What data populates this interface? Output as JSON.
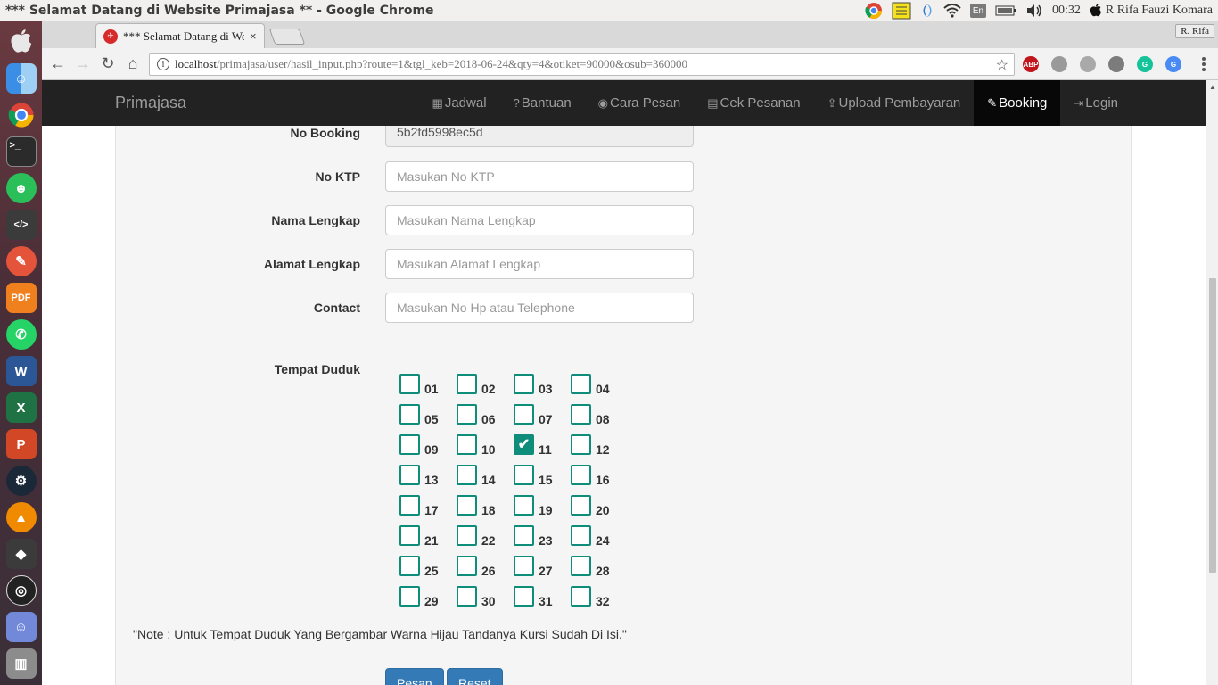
{
  "os": {
    "window_title": "*** Selamat Datang di Website Primajasa ** - Google Chrome",
    "tray": {
      "lang": "En",
      "clock": "00:32",
      "user": "R Rifa Fauzi Komara"
    },
    "launcher_icons": [
      "apple-icon",
      "finder-icon",
      "chrome-icon",
      "terminal-icon",
      "android-icon",
      "code-editor-icon",
      "pen-icon",
      "pdf-icon",
      "whatsapp-icon",
      "word-icon",
      "excel-icon",
      "powerpoint-icon",
      "steam-icon",
      "vlc-icon",
      "inkscape-icon",
      "obs-icon",
      "discord-icon",
      "trash-icon"
    ]
  },
  "browser": {
    "tab_title": "*** Selamat Datang di We",
    "tab_close": "×",
    "profile": "R. Rifa",
    "url_host": "localhost",
    "url_path": "/primajasa/user/hasil_input.php?route=1&tgl_keb=2018-06-24&qty=4&otiket=90000&osub=360000",
    "extensions": [
      {
        "name": "adblock-icon",
        "label": "ABP",
        "color": "#c3161c"
      },
      {
        "name": "extension-cube-icon",
        "label": "",
        "color": "#9a9a9a"
      },
      {
        "name": "globe-icon",
        "label": "",
        "color": "#a9a9a9"
      },
      {
        "name": "chat-icon",
        "label": "",
        "color": "#7c7c7c"
      },
      {
        "name": "grammarly-icon",
        "label": "G",
        "color": "#15c39a"
      },
      {
        "name": "translate-icon",
        "label": "G",
        "color": "#4a8af4"
      }
    ]
  },
  "navbar": {
    "brand": "Primajasa",
    "links": [
      {
        "icon": "▦",
        "label": "Jadwal",
        "name": "nav-jadwal",
        "active": false
      },
      {
        "icon": "?",
        "label": "Bantuan",
        "name": "nav-bantuan",
        "active": false
      },
      {
        "icon": "◉",
        "label": "Cara Pesan",
        "name": "nav-cara-pesan",
        "active": false
      },
      {
        "icon": "▤",
        "label": "Cek Pesanan",
        "name": "nav-cek-pesanan",
        "active": false
      },
      {
        "icon": "⇪",
        "label": "Upload Pembayaran",
        "name": "nav-upload-pembayaran",
        "active": false
      },
      {
        "icon": "✎",
        "label": "Booking",
        "name": "nav-booking",
        "active": true
      },
      {
        "icon": "⇥",
        "label": "Login",
        "name": "nav-login",
        "active": false
      }
    ]
  },
  "form": {
    "no_booking": {
      "label": "No Booking",
      "value": "5b2fd5998ec5d"
    },
    "no_ktp": {
      "label": "No KTP",
      "placeholder": "Masukan No KTP"
    },
    "nama": {
      "label": "Nama Lengkap",
      "placeholder": "Masukan Nama Lengkap"
    },
    "alamat": {
      "label": "Alamat Lengkap",
      "placeholder": "Masukan Alamat Lengkap"
    },
    "contact": {
      "label": "Contact",
      "placeholder": "Masukan No Hp atau Telephone"
    },
    "seats_label": "Tempat Duduk",
    "seats": [
      "01",
      "02",
      "03",
      "04",
      "05",
      "06",
      "07",
      "08",
      "09",
      "10",
      "11",
      "12",
      "13",
      "14",
      "15",
      "16",
      "17",
      "18",
      "19",
      "20",
      "21",
      "22",
      "23",
      "24",
      "25",
      "26",
      "27",
      "28",
      "29",
      "30",
      "31",
      "32"
    ],
    "checked_seats": [
      "11"
    ],
    "check_mark": "✔",
    "note": "\"Note : Untuk Tempat Duduk Yang Bergambar Warna Hijau Tandanya Kursi Sudah Di Isi.\"",
    "submit_label": "Pesan",
    "reset_label": "Reset"
  }
}
